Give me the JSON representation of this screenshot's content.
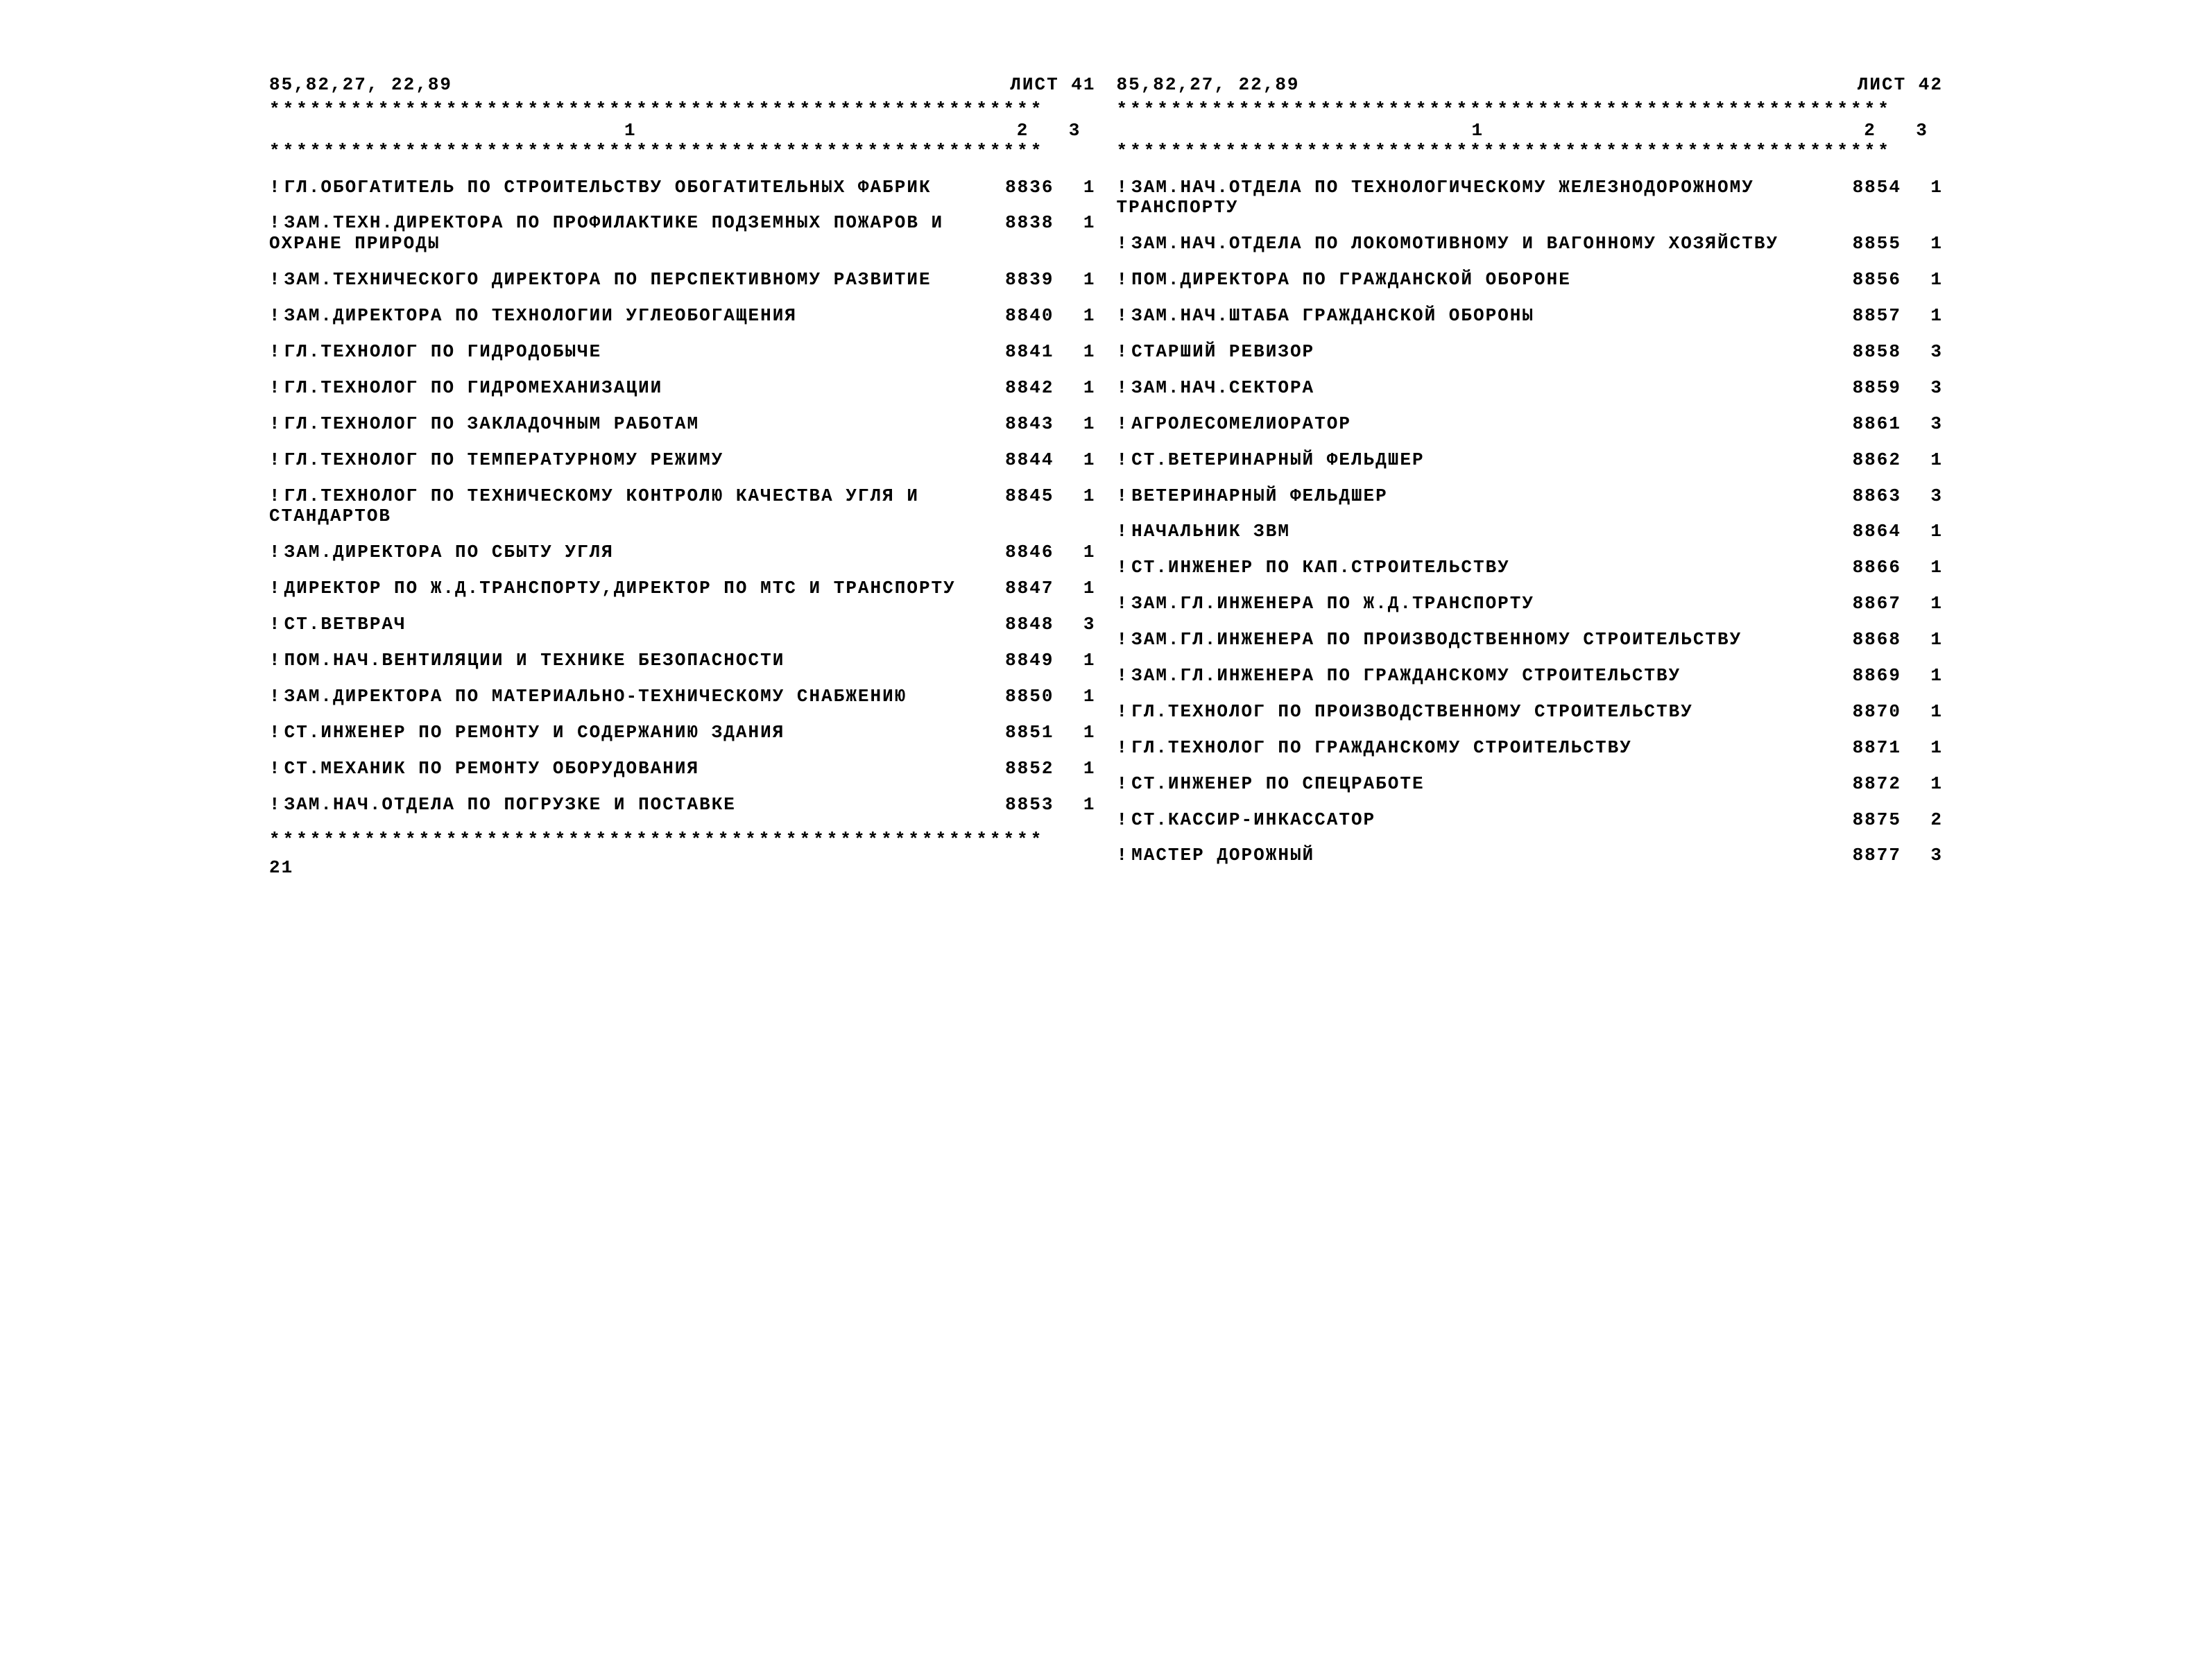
{
  "left": {
    "header_left": "85,82,27, 22,89",
    "header_right": "ЛИСТ  41",
    "col1": "1",
    "col2": "2",
    "col3": "3",
    "rows": [
      {
        "name": "ГЛ.ОБОГАТИТЕЛЬ ПО СТРОИТЕЛЬСТВУ ОБОГАТИТЕЛЬНЫХ ФАБРИК",
        "code": "8836",
        "cnt": "1"
      },
      {
        "name": "ЗАМ.ТЕХН.ДИРЕКТОРА ПО ПРОФИЛАКТИКЕ ПОДЗЕМНЫХ ПОЖАРОВ И ОХРАНЕ ПРИРОДЫ",
        "code": "8838",
        "cnt": "1"
      },
      {
        "name": "ЗАМ.ТЕХНИЧЕСКОГО ДИРЕКТОРА ПО ПЕРСПЕКТИВНОМУ РАЗВИТИЕ",
        "code": "8839",
        "cnt": "1"
      },
      {
        "name": "ЗАМ.ДИРЕКТОРА ПО ТЕХНОЛОГИИ УГЛЕОБОГАЩЕНИЯ",
        "code": "8840",
        "cnt": "1"
      },
      {
        "name": "ГЛ.ТЕХНОЛОГ ПО ГИДРОДОБЫЧЕ",
        "code": "8841",
        "cnt": "1"
      },
      {
        "name": "ГЛ.ТЕХНОЛОГ ПО ГИДРОМЕХАНИЗАЦИИ",
        "code": "8842",
        "cnt": "1"
      },
      {
        "name": "ГЛ.ТЕХНОЛОГ ПО ЗАКЛАДОЧНЫМ РАБОТАМ",
        "code": "8843",
        "cnt": "1"
      },
      {
        "name": "ГЛ.ТЕХНОЛОГ ПО ТЕМПЕРАТУРНОМУ РЕЖИМУ",
        "code": "8844",
        "cnt": "1"
      },
      {
        "name": "ГЛ.ТЕХНОЛОГ ПО ТЕХНИЧЕСКОМУ КОНТРОЛЮ КАЧЕСТВА УГЛЯ И СТАНДАРТОВ",
        "code": "8845",
        "cnt": "1"
      },
      {
        "name": "ЗАМ.ДИРЕКТОРА ПО СБЫТУ УГЛЯ",
        "code": "8846",
        "cnt": "1"
      },
      {
        "name": "ДИРЕКТОР ПО Ж.Д.ТРАНСПОРТУ,ДИРЕКТОР ПО МТС И ТРАНСПОРТУ",
        "code": "8847",
        "cnt": "1"
      },
      {
        "name": "СТ.ВЕТВРАЧ",
        "code": "8848",
        "cnt": "3"
      },
      {
        "name": "ПОМ.НАЧ.ВЕНТИЛЯЦИИ И ТЕХНИКЕ БЕЗОПАСНОСТИ",
        "code": "8849",
        "cnt": "1"
      },
      {
        "name": "ЗАМ.ДИРЕКТОРА ПО МАТЕРИАЛЬНО-ТЕХНИЧЕСКОМУ СНАБЖЕНИЮ",
        "code": "8850",
        "cnt": "1"
      },
      {
        "name": "СТ.ИНЖЕНЕР ПО РЕМОНТУ И СОДЕРЖАНИЮ ЗДАНИЯ",
        "code": "8851",
        "cnt": "1"
      },
      {
        "name": "СТ.МЕХАНИК ПО РЕМОНТУ ОБОРУДОВАНИЯ",
        "code": "8852",
        "cnt": "1"
      },
      {
        "name": "ЗАМ.НАЧ.ОТДЕЛА ПО ПОГРУЗКЕ И ПОСТАВКЕ",
        "code": "8853",
        "cnt": "1"
      }
    ],
    "foot": "21"
  },
  "right": {
    "header_left": "85,82,27, 22,89",
    "header_right": "ЛИСТ  42",
    "col1": "1",
    "col2": "2",
    "col3": "3",
    "rows": [
      {
        "name": "ЗАМ.НАЧ.ОТДЕЛА ПО ТЕХНОЛОГИЧЕСКОМУ ЖЕЛЕЗНОДОРОЖНОМУ ТРАНСПОРТУ",
        "code": "8854",
        "cnt": "1"
      },
      {
        "name": "ЗАМ.НАЧ.ОТДЕЛА ПО ЛОКОМОТИВНОМУ И ВАГОННОМУ ХОЗЯЙСТВУ",
        "code": "8855",
        "cnt": "1"
      },
      {
        "name": "ПОМ.ДИРЕКТОРА ПО ГРАЖДАНСКОЙ ОБОРОНЕ",
        "code": "8856",
        "cnt": "1"
      },
      {
        "name": "ЗАМ.НАЧ.ШТАБА ГРАЖДАНСКОЙ ОБОРОНЫ",
        "code": "8857",
        "cnt": "1"
      },
      {
        "name": "СТАРШИЙ РЕВИЗОР",
        "code": "8858",
        "cnt": "3"
      },
      {
        "name": "ЗАМ.НАЧ.СЕКТОРА",
        "code": "8859",
        "cnt": "3"
      },
      {
        "name": "АГРОЛЕСОМЕЛИОРАТОР",
        "code": "8861",
        "cnt": "3"
      },
      {
        "name": "СТ.ВЕТЕРИНАРНЫЙ ФЕЛЬДШЕР",
        "code": "8862",
        "cnt": "1"
      },
      {
        "name": "ВЕТЕРИНАРНЫЙ ФЕЛЬДШЕР",
        "code": "8863",
        "cnt": "3"
      },
      {
        "name": "НАЧАЛЬНИК ЗВМ",
        "code": "8864",
        "cnt": "1"
      },
      {
        "name": "СТ.ИНЖЕНЕР ПО КАП.СТРОИТЕЛЬСТВУ",
        "code": "8866",
        "cnt": "1"
      },
      {
        "name": "ЗАМ.ГЛ.ИНЖЕНЕРА ПО Ж.Д.ТРАНСПОРТУ",
        "code": "8867",
        "cnt": "1"
      },
      {
        "name": "ЗАМ.ГЛ.ИНЖЕНЕРА ПО ПРОИЗВОДСТВЕННОМУ СТРОИТЕЛЬСТВУ",
        "code": "8868",
        "cnt": "1"
      },
      {
        "name": "ЗАМ.ГЛ.ИНЖЕНЕРА ПО ГРАЖДАНСКОМУ СТРОИТЕЛЬСТВУ",
        "code": "8869",
        "cnt": "1"
      },
      {
        "name": "ГЛ.ТЕХНОЛОГ ПО ПРОИЗВОДСТВЕННОМУ СТРОИТЕЛЬСТВУ",
        "code": "8870",
        "cnt": "1"
      },
      {
        "name": "ГЛ.ТЕХНОЛОГ ПО ГРАЖДАНСКОМУ СТРОИТЕЛЬСТВУ",
        "code": "8871",
        "cnt": "1"
      },
      {
        "name": "СТ.ИНЖЕНЕР ПО СПЕЦРАБОТЕ",
        "code": "8872",
        "cnt": "1"
      },
      {
        "name": "СТ.КАССИР-ИНКАССАТОР",
        "code": "8875",
        "cnt": "2"
      },
      {
        "name": "МАСТЕР ДОРОЖНЫЙ",
        "code": "8877",
        "cnt": "3"
      }
    ],
    "foot": ""
  },
  "divider": "*********************************************************"
}
